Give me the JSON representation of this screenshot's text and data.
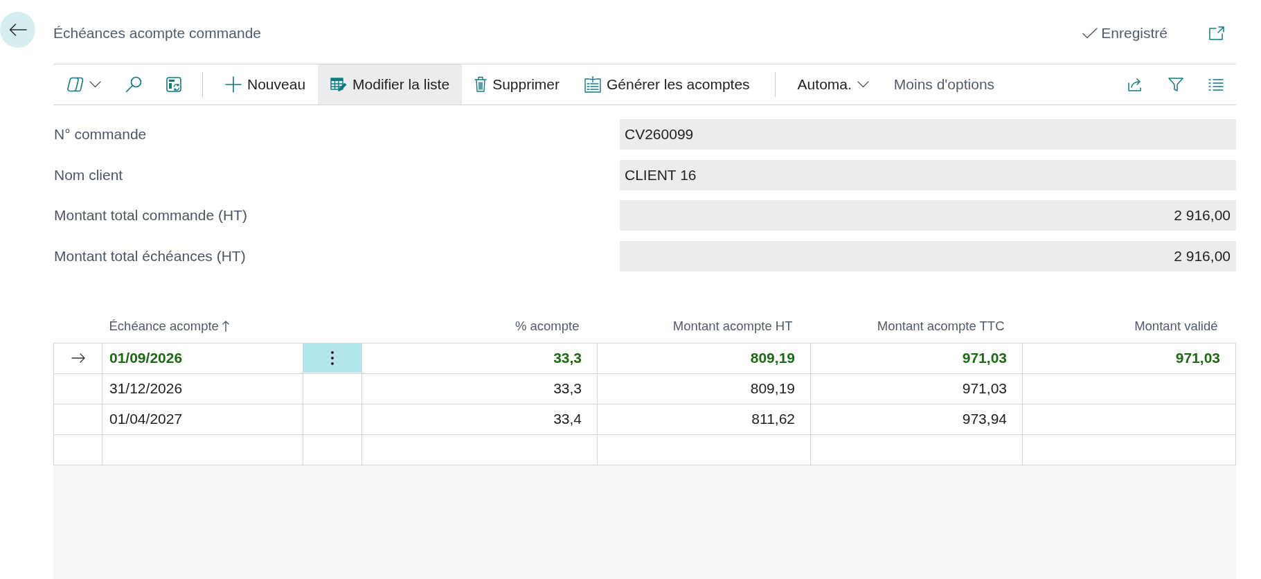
{
  "page": {
    "title": "Échéances acompte commande",
    "save_status": "Enregistré"
  },
  "toolbar": {
    "actions": [
      {
        "kind": "new",
        "label": "Nouveau",
        "highlighted": false
      },
      {
        "kind": "edit",
        "label": "Modifier la liste",
        "highlighted": true
      },
      {
        "kind": "delete",
        "label": "Supprimer",
        "highlighted": false
      },
      {
        "kind": "generate",
        "label": "Générer les acomptes",
        "highlighted": false
      }
    ],
    "menus": [
      {
        "kind": "dropdown",
        "label": "Automa."
      },
      {
        "kind": "link",
        "label": "Moins d'options"
      }
    ]
  },
  "fields": [
    {
      "kind": "text",
      "label": "N° commande",
      "value": "CV260099"
    },
    {
      "kind": "text",
      "label": "Nom client",
      "value": "CLIENT 16"
    },
    {
      "kind": "amount",
      "label": "Montant total commande (HT)",
      "value": "2 916,00"
    },
    {
      "kind": "amount",
      "label": "Montant total échéances (HT)",
      "value": "2 916,00"
    }
  ],
  "table": {
    "columns": [
      {
        "label": "Échéance acompte",
        "sorted": true
      },
      {
        "label": "% acompte",
        "sorted": false
      },
      {
        "label": "Montant acompte HT",
        "sorted": false
      },
      {
        "label": "Montant acompte TTC",
        "sorted": false
      },
      {
        "label": "Montant validé",
        "sorted": false
      }
    ],
    "rows": [
      {
        "selected": true,
        "due_date": "01/09/2026",
        "percent": "33,3",
        "amount_ht": "809,19",
        "amount_ttc": "971,03",
        "validated_amount": "971,03"
      },
      {
        "selected": false,
        "due_date": "31/12/2026",
        "percent": "33,3",
        "amount_ht": "809,19",
        "amount_ttc": "971,03"
      },
      {
        "selected": false,
        "due_date": "01/04/2027",
        "percent": "33,4",
        "amount_ht": "811,62",
        "amount_ttc": "973,94"
      }
    ]
  }
}
